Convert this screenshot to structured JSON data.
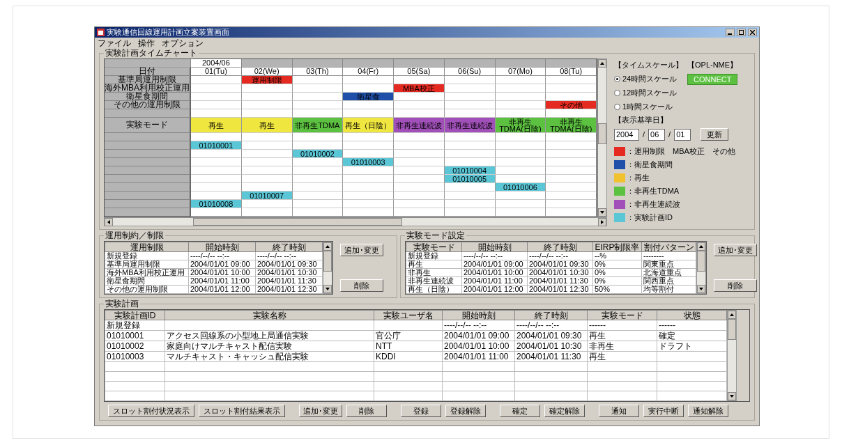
{
  "window": {
    "title": "実験通信回線運用計画立案装置画面"
  },
  "menu": [
    "ファイル",
    "操作",
    "オプション"
  ],
  "timechart": {
    "title": "実験計画タイムチャート",
    "month": "2004/06",
    "date_label": "日付",
    "days": [
      "01(Tu)",
      "02(We)",
      "03(Th)",
      "04(Fr)",
      "05(Sa)",
      "06(Su)",
      "07(Mo)",
      "08(Tu)"
    ],
    "rows": [
      {
        "label": "基準局運用制限",
        "cells": [
          null,
          {
            "kind": "restriction",
            "text": "運用制限"
          },
          null,
          null,
          null,
          null,
          null,
          null
        ]
      },
      {
        "label": "海外MBA利用校正運用",
        "cells": [
          null,
          null,
          null,
          null,
          {
            "kind": "restriction",
            "text": "MBA校正"
          },
          null,
          null,
          null
        ]
      },
      {
        "label": "衛星食期間",
        "cells": [
          null,
          null,
          null,
          {
            "kind": "eclipse",
            "text": "衛星食"
          },
          null,
          null,
          null,
          null
        ]
      },
      {
        "label": "その他の運用制限",
        "cells": [
          null,
          null,
          null,
          null,
          null,
          null,
          null,
          {
            "kind": "restriction",
            "text": "その他"
          }
        ]
      },
      {
        "cells": [
          null,
          null,
          null,
          null,
          null,
          null,
          null,
          null
        ]
      },
      {
        "label": "実験モード",
        "cells": [
          {
            "kind": "playback",
            "text": "再生"
          },
          {
            "kind": "playback",
            "text": "再生"
          },
          {
            "kind": "tdma",
            "text": "非再生TDMA"
          },
          {
            "kind": "playback",
            "text": "再生（日陰）"
          },
          {
            "kind": "continuous",
            "text": "非再生連続波"
          },
          {
            "kind": "continuous",
            "text": "非再生連続波"
          },
          {
            "kind": "tdma",
            "text": "非再生TDMA(日陰)"
          },
          {
            "kind": "tdma",
            "text": "非再生TDMA(日陰)"
          }
        ]
      },
      {
        "cells": [
          null,
          null,
          null,
          null,
          null,
          null,
          null,
          null
        ]
      },
      {
        "cells": [
          {
            "kind": "plan",
            "text": "01010001"
          },
          null,
          null,
          null,
          null,
          null,
          null,
          null
        ]
      },
      {
        "cells": [
          null,
          null,
          {
            "kind": "plan",
            "text": "01010002"
          },
          null,
          null,
          null,
          null,
          null
        ]
      },
      {
        "cells": [
          null,
          null,
          null,
          {
            "kind": "plan",
            "text": "01010003"
          },
          null,
          null,
          null,
          null
        ]
      },
      {
        "cells": [
          null,
          null,
          null,
          null,
          null,
          {
            "kind": "plan",
            "text": "01010004"
          },
          null,
          null
        ]
      },
      {
        "cells": [
          null,
          null,
          null,
          null,
          null,
          {
            "kind": "plan",
            "text": "01010005"
          },
          null,
          null
        ]
      },
      {
        "cells": [
          null,
          null,
          null,
          null,
          null,
          null,
          {
            "kind": "plan",
            "text": "01010006"
          },
          null
        ]
      },
      {
        "cells": [
          null,
          {
            "kind": "plan",
            "text": "01010007"
          },
          null,
          null,
          null,
          null,
          null,
          null
        ]
      },
      {
        "cells": [
          {
            "kind": "plan",
            "text": "01010008"
          },
          null,
          null,
          null,
          null,
          null,
          null,
          null
        ]
      },
      {
        "cells": [
          null,
          null,
          null,
          null,
          null,
          null,
          null,
          null
        ]
      }
    ]
  },
  "timescale": {
    "title": "【タイムスケール】",
    "options": [
      {
        "label": "24時間スケール",
        "selected": true
      },
      {
        "label": "12時間スケール",
        "selected": false
      },
      {
        "label": "1時間スケール",
        "selected": false
      }
    ]
  },
  "opl": {
    "title": "【OPL-NME】",
    "button": "CONNECT"
  },
  "base_date": {
    "title": "【表示基準日】",
    "year": "2004",
    "month": "06",
    "day": "01",
    "separator": "/",
    "button": "更新"
  },
  "legend": [
    {
      "color": "#e52a22",
      "text": "：運用制限　MBA校正　その他"
    },
    {
      "color": "#1f4fa8",
      "text": "：衛星食期間"
    },
    {
      "color": "#f2c12e",
      "text": "：再生"
    },
    {
      "color": "#5cc040",
      "text": "：非再生TDMA"
    },
    {
      "color": "#a050b8",
      "text": "：非再生連続波"
    },
    {
      "color": "#5bc6d6",
      "text": "：実験計画ID"
    }
  ],
  "restrictions": {
    "title": "運用制約／制限",
    "columns": [
      "運用制限",
      "開始時刻",
      "終了時刻"
    ],
    "rows": [
      [
        "新規登録",
        "----/--/-- --:--",
        "----/--/-- --:--"
      ],
      [
        "基準局運用制限",
        "2004/01/01 09:00",
        "2004/01/01 09:30"
      ],
      [
        "海外MBA利用校正運用",
        "2004/01/01 10:00",
        "2004/01/01 10:30"
      ],
      [
        "衛星食期間",
        "2004/01/01 11:00",
        "2004/01/01 11:30"
      ],
      [
        "その他の運用制限",
        "2004/01/01 12:00",
        "2004/01/01 12:30"
      ]
    ],
    "buttons": [
      "追加･変更",
      "削除"
    ]
  },
  "modes": {
    "title": "実験モード設定",
    "columns": [
      "実験モード",
      "開始時刻",
      "終了時刻",
      "EIRP制限率",
      "割付パターン"
    ],
    "rows": [
      [
        "新規登録",
        "----/--/-- --:--",
        "----/--/-- --:--",
        "--%",
        "--------"
      ],
      [
        "再生",
        "2004/01/01 09:00",
        "2004/01/01 09:30",
        "0%",
        "関東重点"
      ],
      [
        "非再生",
        "2004/01/01 10:00",
        "2004/01/01 10:30",
        "0%",
        "北海道重点"
      ],
      [
        "非再生連続波",
        "2004/01/01 11:00",
        "2004/01/01 11:30",
        "0%",
        "関西重点"
      ],
      [
        "再生（日陰）",
        "2004/01/01 12:00",
        "2004/01/01 12:30",
        "50%",
        "均等割付"
      ]
    ],
    "buttons": [
      "追加･変更",
      "削除"
    ]
  },
  "plans": {
    "title": "実験計画",
    "columns": [
      "実験計画ID",
      "実験名称",
      "実験ユーザ名",
      "開始時刻",
      "終了時刻",
      "実験モード",
      "状態"
    ],
    "rows": [
      [
        "新規登録",
        null,
        null,
        "----/--/-- --:--",
        "----/--/-- --:--",
        "------",
        "------"
      ],
      [
        "01010001",
        "アクセス回線系の小型地上局通信実験",
        "官公庁",
        "2004/01/01 09:00",
        "2004/01/01 09:30",
        "再生",
        "確定"
      ],
      [
        "01010002",
        "家庭向けマルチキャスト配信実験",
        "NTT",
        "2004/01/01 10:00",
        "2004/01/01 10:30",
        "非再生",
        "ドラフト"
      ],
      [
        "01010003",
        "マルチキャスト・キャッシュ配信実験",
        "KDDI",
        "2004/01/01 11:00",
        "2004/01/01 11:30",
        "再生",
        null
      ]
    ]
  },
  "footer_buttons": [
    "スロット割付状況表示",
    "スロット割付結果表示",
    "追加･変更",
    "削除",
    "登録",
    "登録解除",
    "確定",
    "確定解除",
    "通知",
    "実行中断",
    "通知解除"
  ]
}
